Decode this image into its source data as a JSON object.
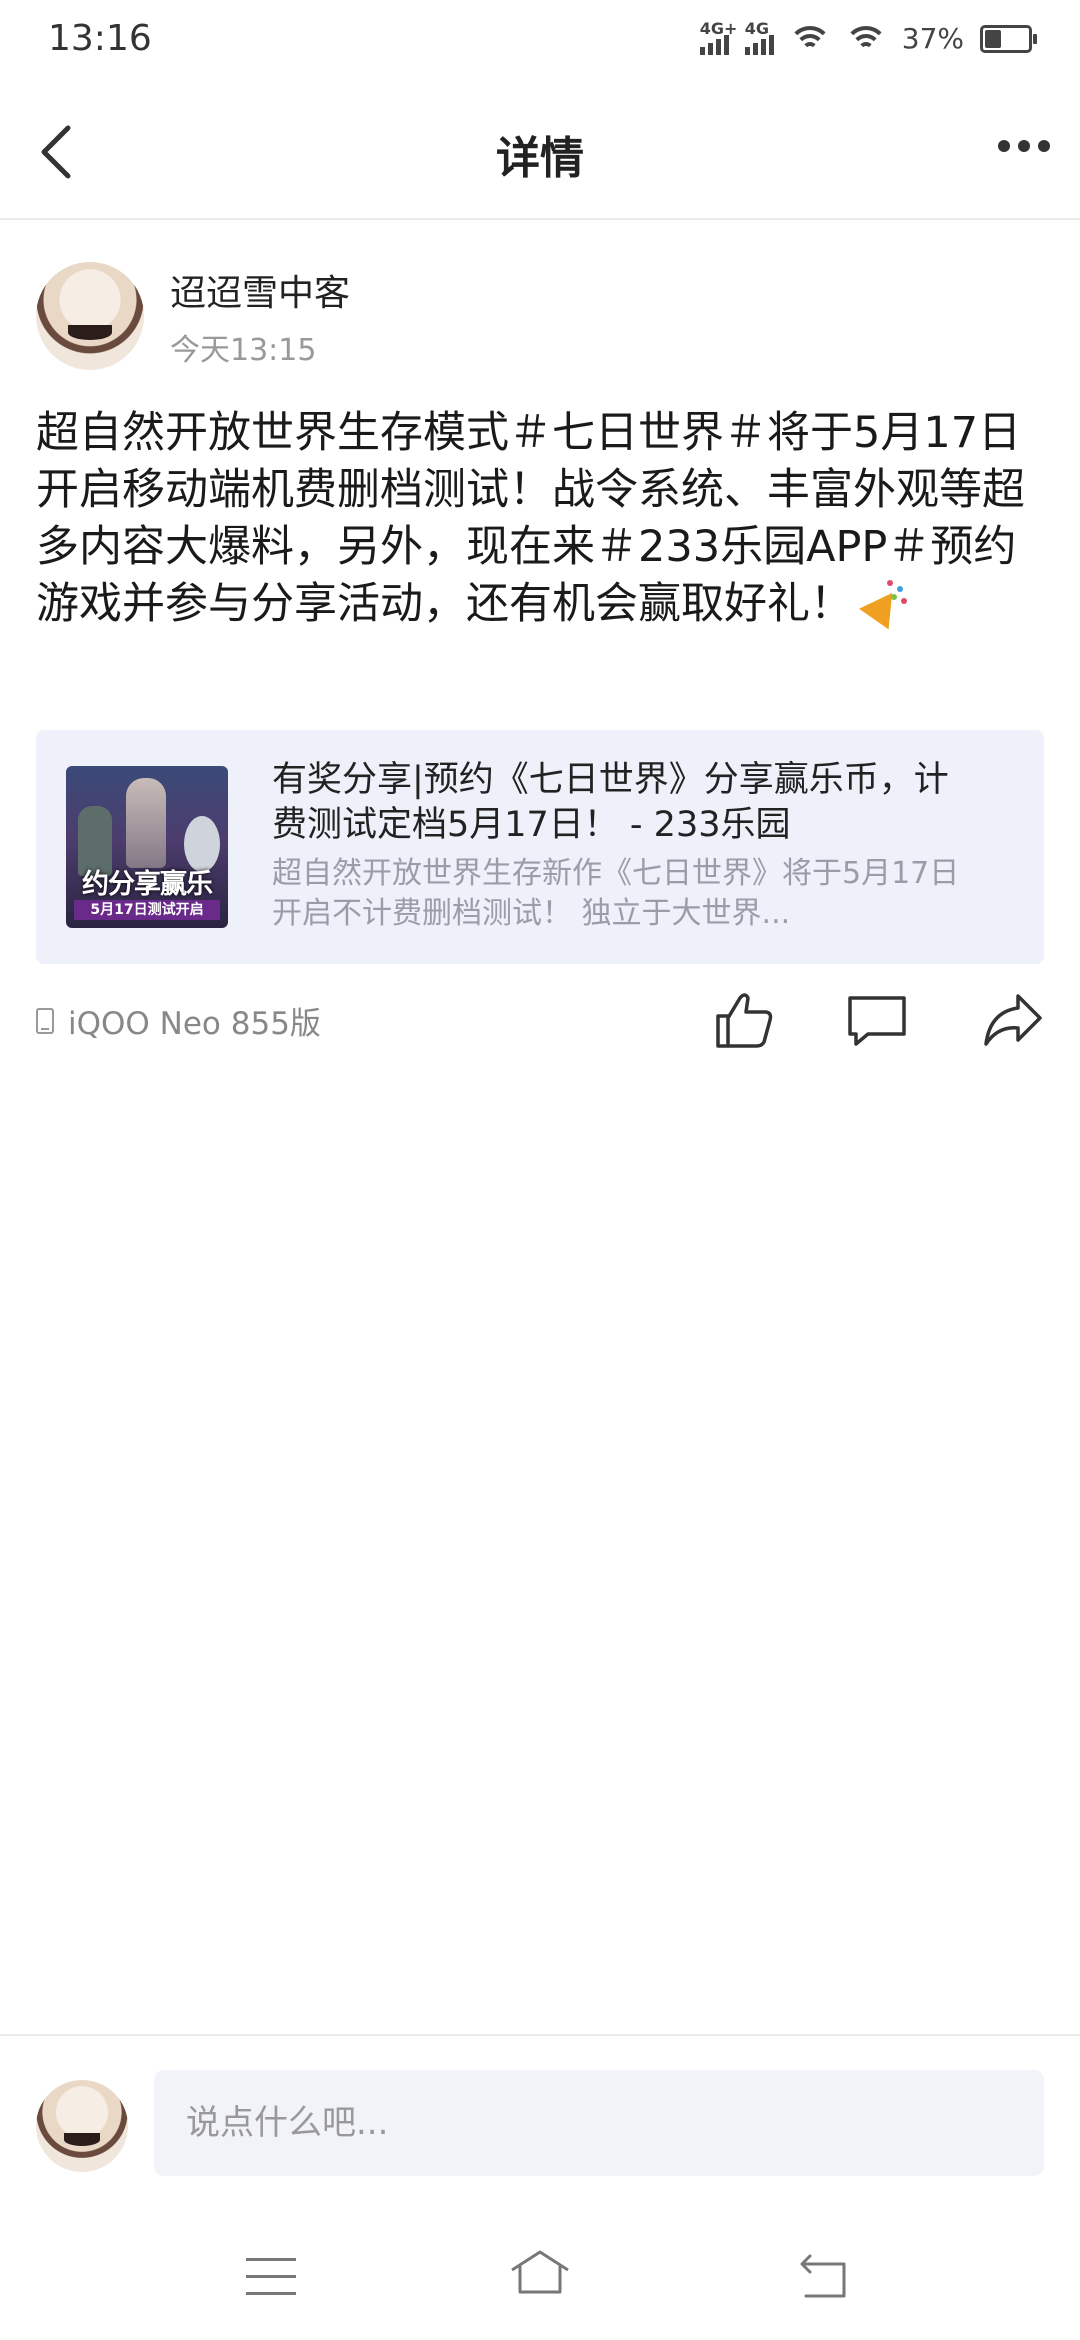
{
  "status_bar": {
    "time": "13:16",
    "signal1_label": "4G+",
    "signal2_label": "4G",
    "battery_percent": "37%",
    "battery_level": 0.37,
    "icons": [
      "signal-icon",
      "signal-icon",
      "wifi-icon",
      "wifi-icon",
      "battery-icon"
    ]
  },
  "nav": {
    "title": "详情",
    "back_icon": "back-arrow-icon",
    "more_icon": "more-icon"
  },
  "post": {
    "username": "迢迢雪中客",
    "time": "今天13:15",
    "content": "超自然开放世界生存模式＃七日世界＃将于5月17日开启移动端机费删档测试！战令系统、丰富外观等超多内容大爆料，另外，现在来＃233乐园APP＃预约游戏并参与分享活动，还有机会赢取好礼！",
    "emoji": "party-popper-icon"
  },
  "link_card": {
    "thumb_title": "约分享赢乐",
    "thumb_subtitle": "5月17日测试开启",
    "title": "有奖分享|预约《七日世界》分享赢乐币，计费测试定档5月17日！ - 233乐园",
    "description": "超自然开放世界生存新作《七日世界》将于5月17日开启不计费删档测试！ 独立于大世界..."
  },
  "footer": {
    "device": "iQOO Neo 855版",
    "actions": [
      "like-icon",
      "comment-icon",
      "share-icon"
    ]
  },
  "comment_bar": {
    "placeholder": "说点什么吧..."
  },
  "system_nav": [
    "menu-icon",
    "home-icon",
    "back-icon"
  ]
}
